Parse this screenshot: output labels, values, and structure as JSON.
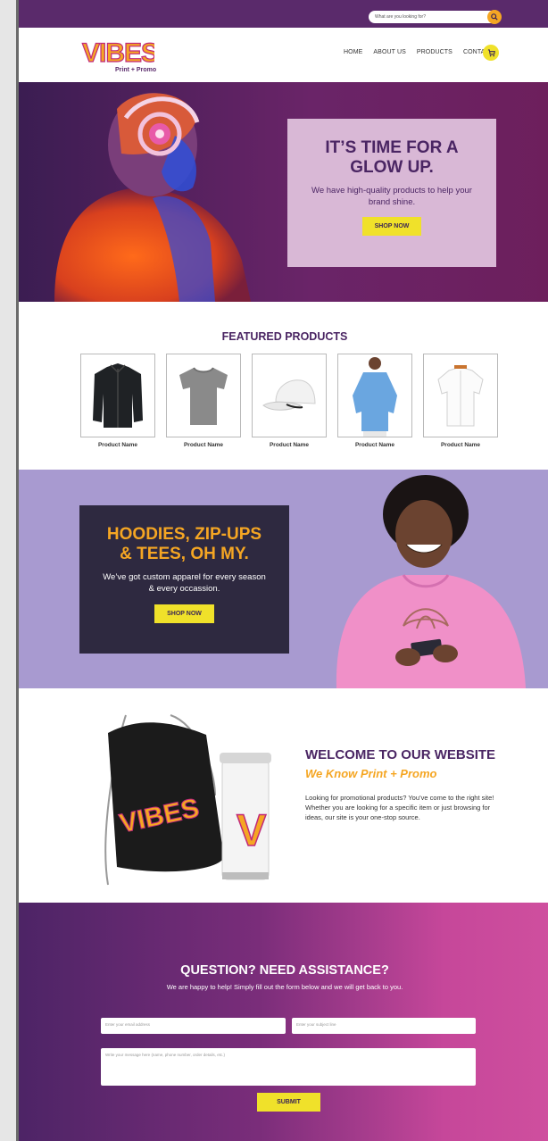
{
  "topbar": {
    "search_placeholder": "What are you looking for?"
  },
  "logo": {
    "text": "VIBES",
    "subtitle": "Print + Promo"
  },
  "nav": {
    "items": [
      "HOME",
      "ABOUT US",
      "PRODUCTS",
      "CONTACT"
    ]
  },
  "hero": {
    "title_line1": "IT’S TIME FOR A",
    "title_line2": "GLOW UP.",
    "text": "We have high-quality products to help your brand shine.",
    "button": "SHOP NOW"
  },
  "featured": {
    "title": "FEATURED PRODUCTS",
    "products": [
      {
        "name": "Product Name",
        "icon": "jacket-icon"
      },
      {
        "name": "Product Name",
        "icon": "tshirt-icon"
      },
      {
        "name": "Product Name",
        "icon": "cap-icon"
      },
      {
        "name": "Product Name",
        "icon": "longsleeve-icon"
      },
      {
        "name": "Product Name",
        "icon": "dress-shirt-icon"
      }
    ]
  },
  "apparel": {
    "title_line1": "HOODIES, ZIP-UPS",
    "title_line2": "& TEES, OH MY.",
    "text": "We’ve got custom apparel for every season & every occassion.",
    "button": "SHOP NOW"
  },
  "welcome": {
    "title": "WELCOME TO OUR WEBSITE",
    "subtitle": "We Know Print + Promo",
    "text": "Looking for promotional products? You’ve come to the right site! Whether you are looking for a specific item or just browsing for ideas, our site is your one-stop source.",
    "bag_text": "VIBES",
    "tumbler_text": "V"
  },
  "contact": {
    "title": "QUESTION? NEED ASSISTANCE?",
    "subtitle": "We are happy to help! Simply fill out the form below and we will get back to you.",
    "email_placeholder": "Enter your email address",
    "subject_placeholder": "Enter your subject line",
    "message_placeholder": "Write your message here (name, phone number, order details, etc.)",
    "submit": "SUBMIT"
  },
  "colors": {
    "purple": "#4a2563",
    "yellow": "#f0e12a",
    "orange": "#f5a623",
    "lavender": "#a89ad0",
    "pink": "#cf4f9e"
  }
}
